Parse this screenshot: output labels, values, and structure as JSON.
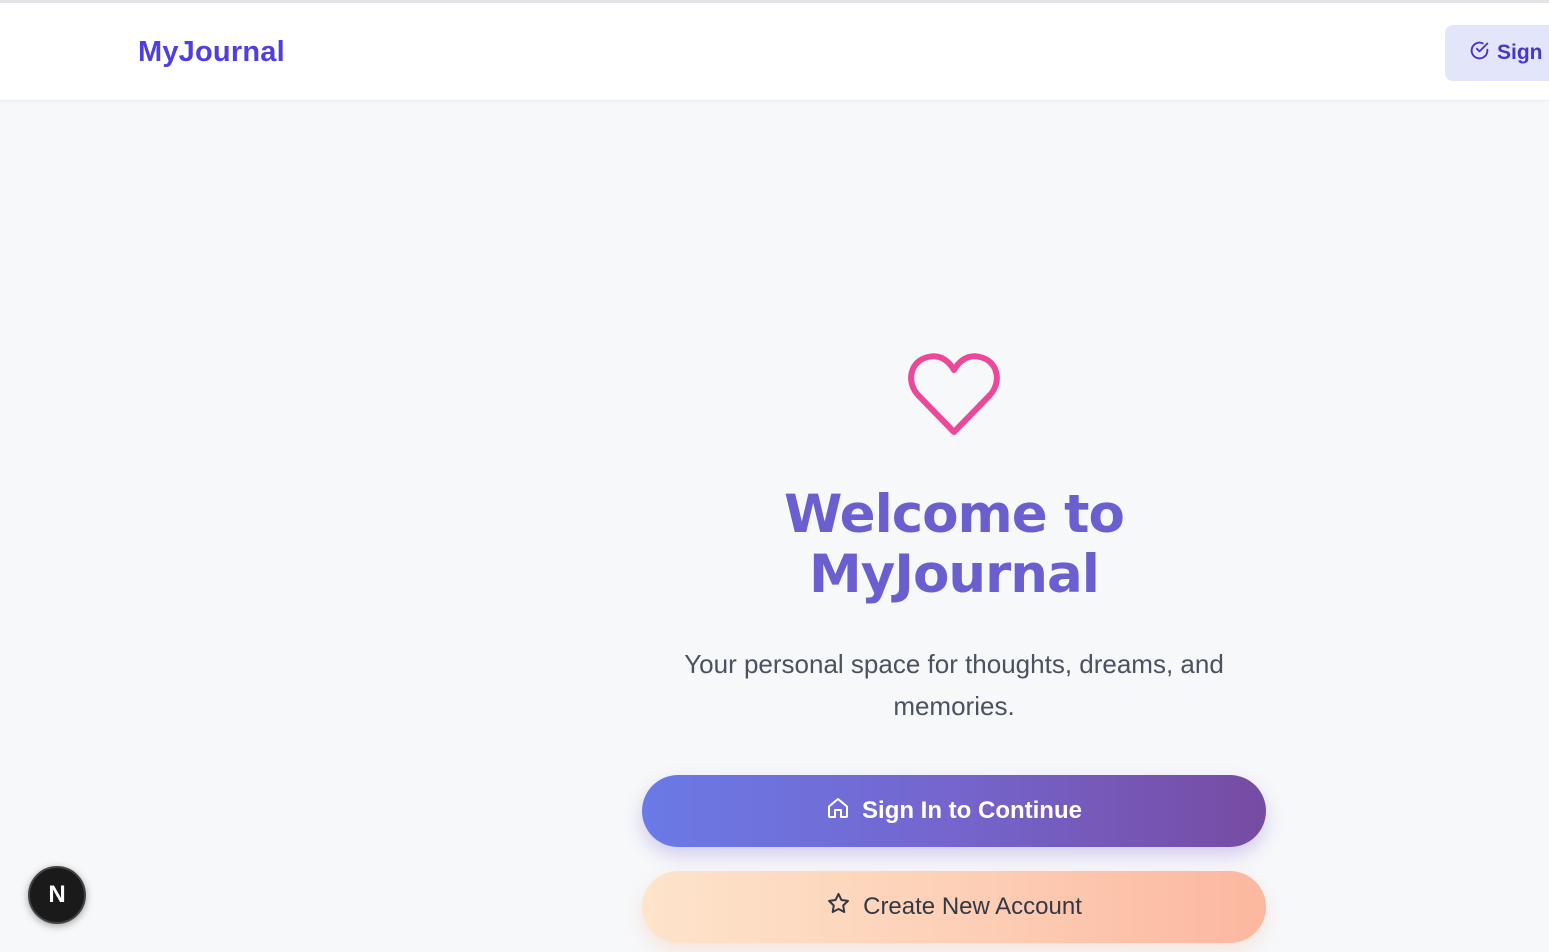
{
  "header": {
    "brand": "MyJournal",
    "signin_label": "Sign In"
  },
  "hero": {
    "icon": "heart-icon",
    "title_line1": "Welcome to",
    "title_line2": "MyJournal",
    "subtitle_line1": "Your personal space for thoughts, dreams, and",
    "subtitle_line2": "memories.",
    "primary_button": {
      "label": "Sign In to Continue",
      "icon": "home-icon"
    },
    "secondary_button": {
      "label": "Create New Account",
      "icon": "star-icon"
    }
  },
  "dev_badge": {
    "label": "N"
  },
  "colors": {
    "brand": "#4f3fe0",
    "heart": "#ec4899",
    "title": "#6a5fcf",
    "primary_gradient_start": "#6a7ae6",
    "primary_gradient_end": "#764ba2",
    "secondary_gradient_start": "#fde4cb",
    "secondary_gradient_end": "#fcb79f",
    "background": "#f7f8fa"
  }
}
